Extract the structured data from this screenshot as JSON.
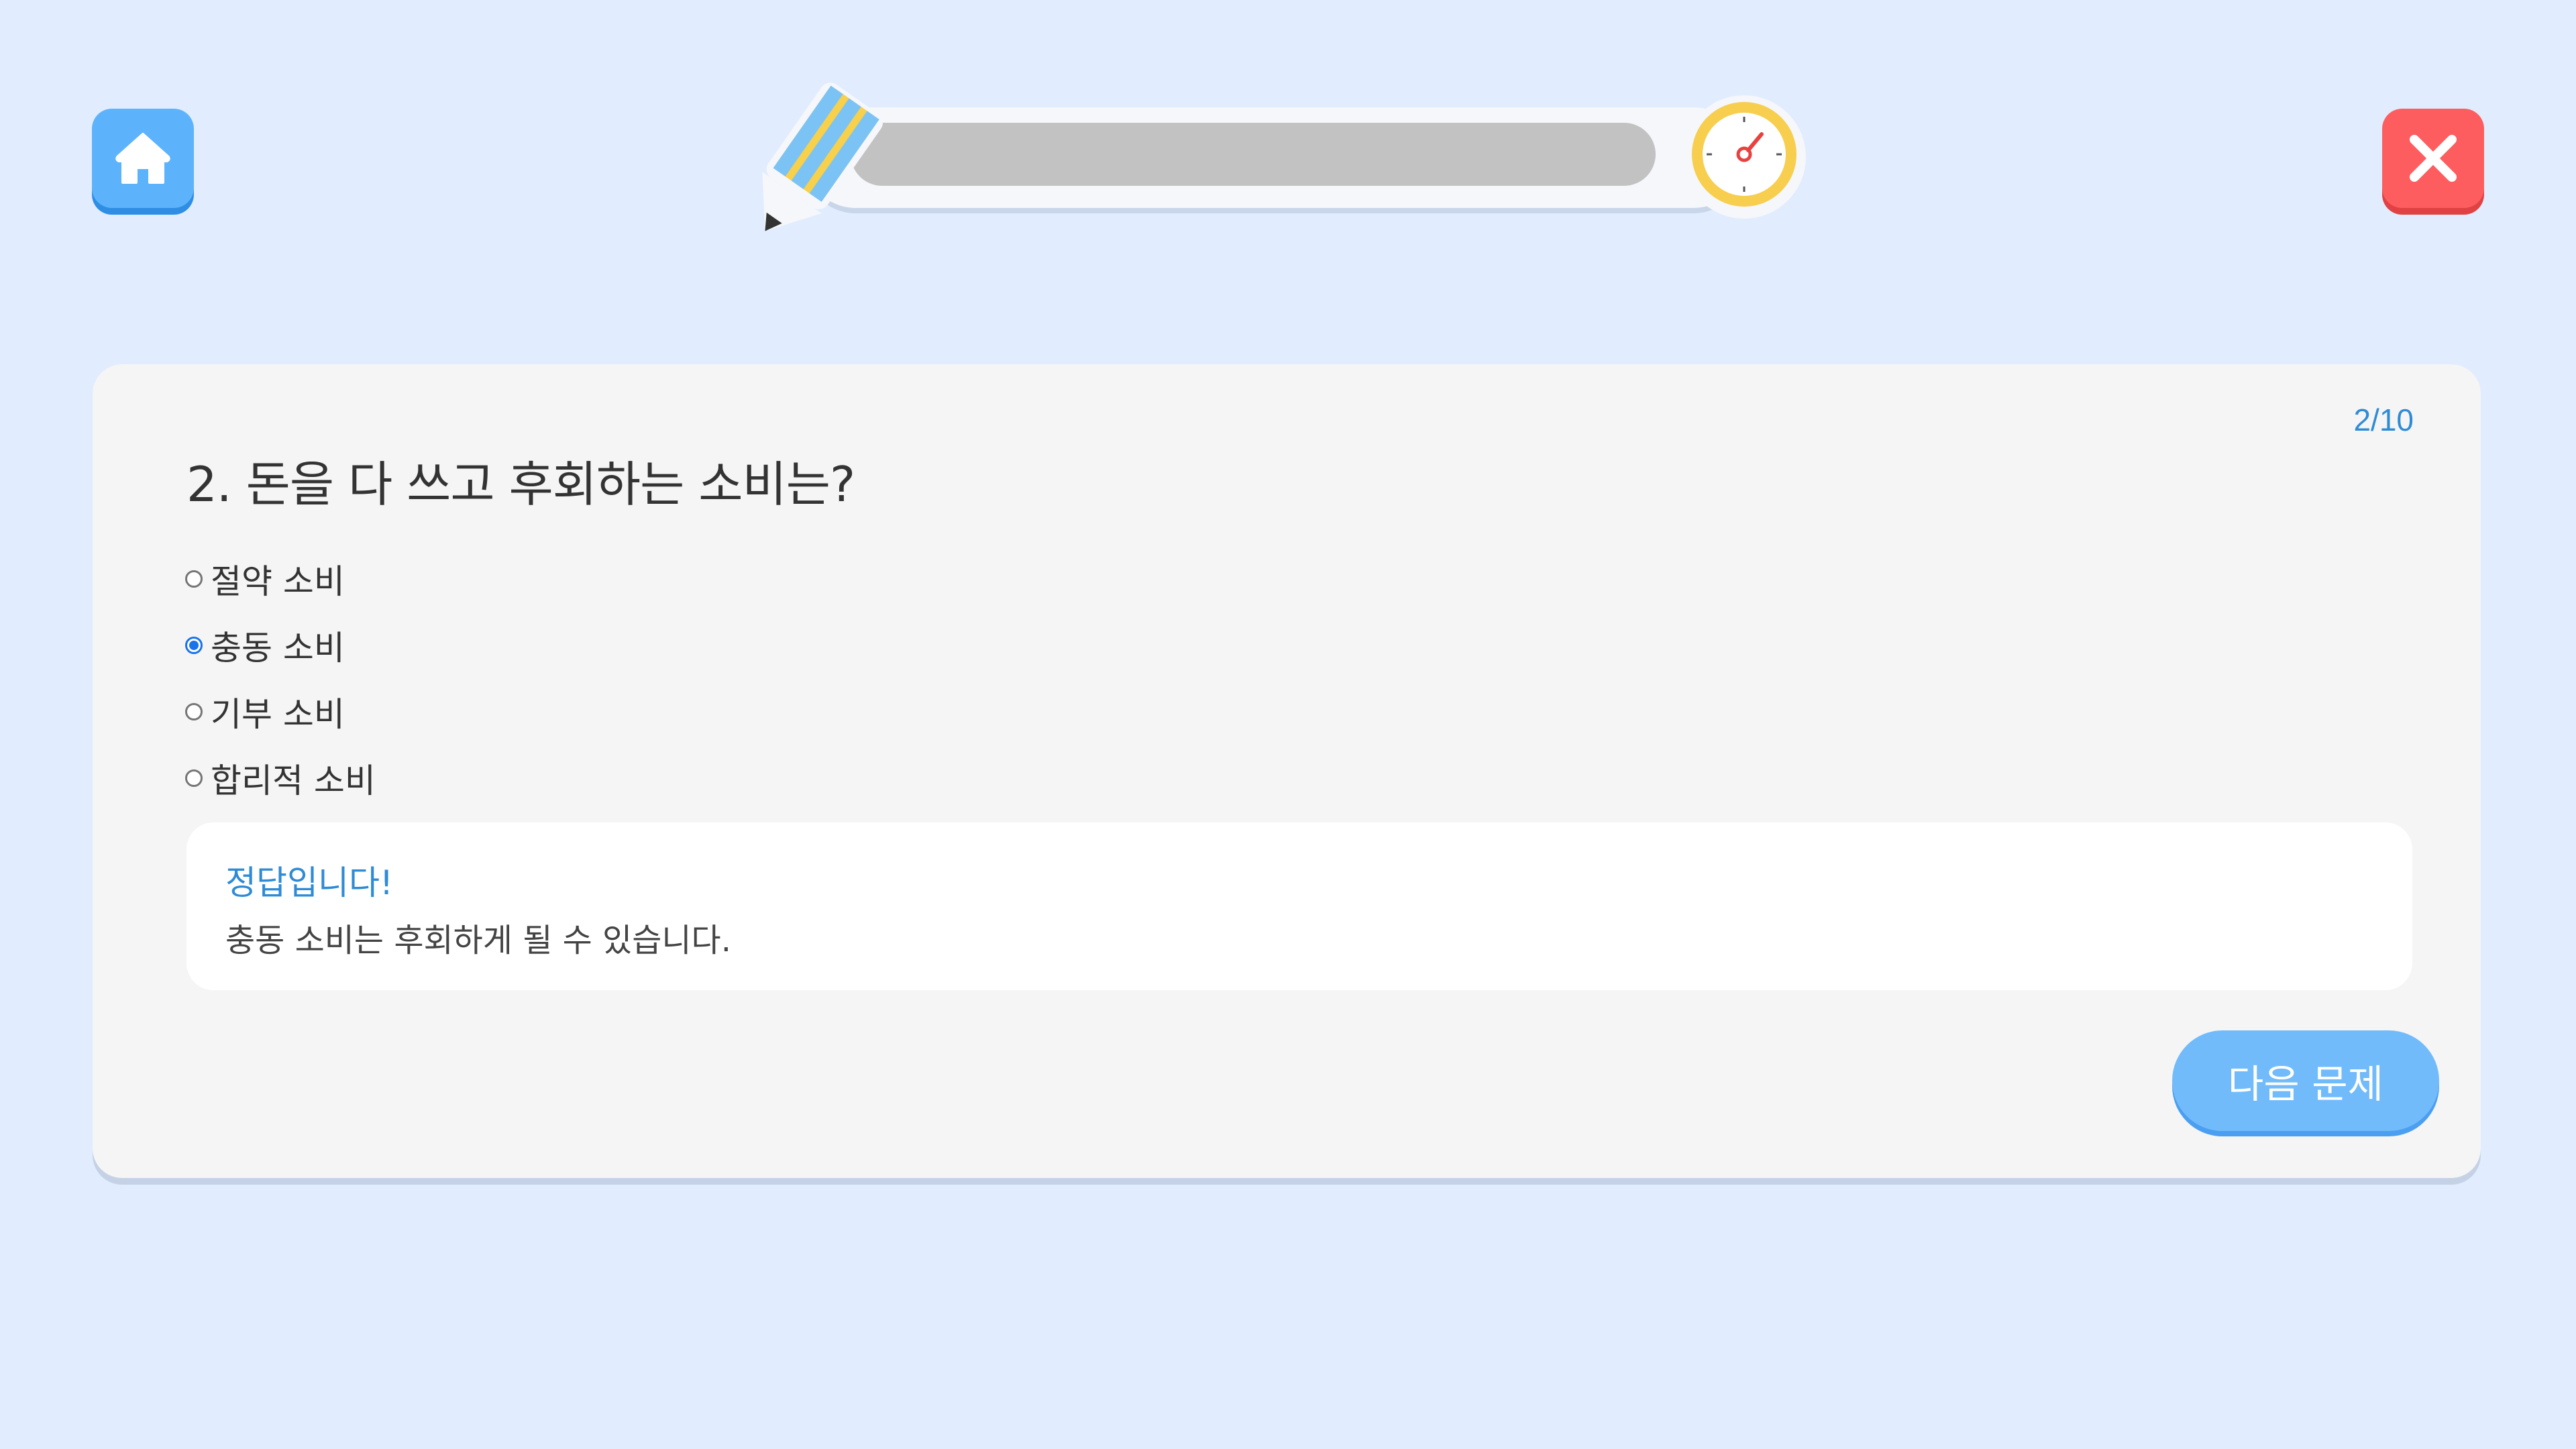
{
  "header": {
    "home_icon": "home-icon",
    "close_icon": "close-icon",
    "pencil_icon": "pencil-icon",
    "timer_icon": "stopwatch-icon",
    "timer_progress": 0.0
  },
  "quiz": {
    "counter": "2/10",
    "question": "2. 돈을 다 쓰고 후회하는 소비는?",
    "options": [
      {
        "label": "절약 소비",
        "selected": false
      },
      {
        "label": "충동 소비",
        "selected": true
      },
      {
        "label": "기부 소비",
        "selected": false
      },
      {
        "label": "합리적 소비",
        "selected": false
      }
    ],
    "feedback": {
      "title": "정답입니다!",
      "text": "충동 소비는 후회하게 될 수 있습니다."
    },
    "next_label": "다음 문제"
  },
  "colors": {
    "background": "#e1ecfe",
    "home_button": "#5db3fb",
    "close_button": "#fd5d5f",
    "accent": "#2f8bd6",
    "next_button": "#72bbfb"
  }
}
